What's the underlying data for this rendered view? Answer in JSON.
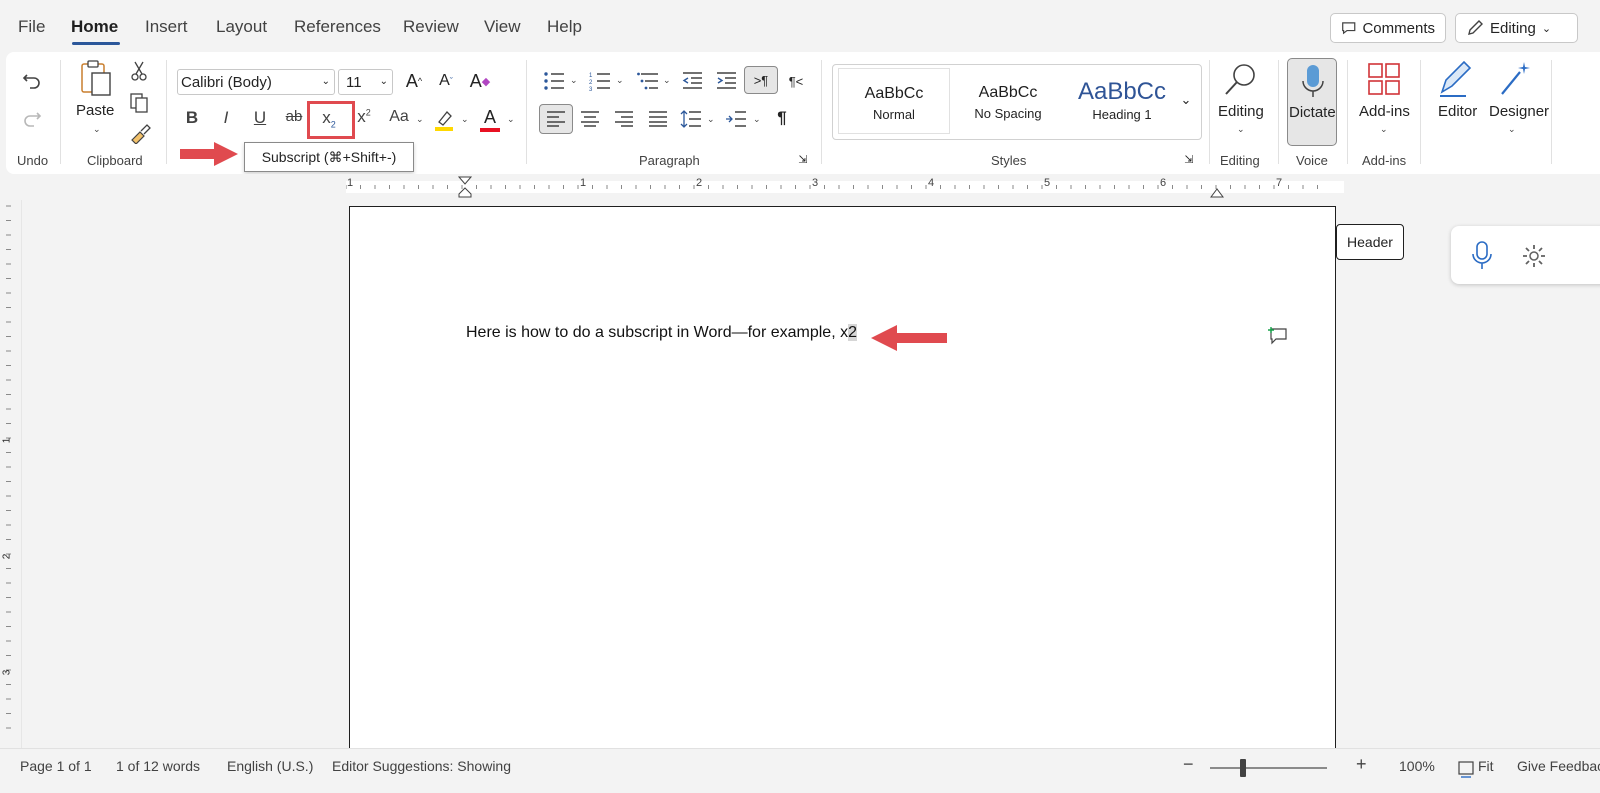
{
  "menu": {
    "tabs": [
      {
        "label": "File"
      },
      {
        "label": "Home"
      },
      {
        "label": "Insert"
      },
      {
        "label": "Layout"
      },
      {
        "label": "References"
      },
      {
        "label": "Review"
      },
      {
        "label": "View"
      },
      {
        "label": "Help"
      }
    ],
    "active_tab": "Home",
    "comments_label": "Comments",
    "editing_label": "Editing"
  },
  "ribbon": {
    "groups": {
      "undo": "Undo",
      "clipboard": "Clipboard",
      "paragraph": "Paragraph",
      "styles": "Styles",
      "editing": "Editing",
      "voice": "Voice",
      "addins": "Add-ins"
    },
    "paste_label": "Paste",
    "font_name": "Calibri (Body)",
    "font_size": "11",
    "styles": [
      {
        "sample": "AaBbCc",
        "name": "Normal"
      },
      {
        "sample": "AaBbCc",
        "name": "No Spacing"
      },
      {
        "sample": "AaBbCc",
        "name": "Heading 1"
      }
    ],
    "editing_btn": "Editing",
    "dictate_btn": "Dictate",
    "addins_btn": "Add-ins",
    "editor_btn": "Editor",
    "designer_btn": "Designer",
    "font_color": "#e81123",
    "highlight_color": "#ffd800"
  },
  "tooltip": "Subscript (⌘+Shift+-)",
  "ruler_numbers": [
    "1",
    "1",
    "2",
    "3",
    "4",
    "5",
    "6",
    "7"
  ],
  "vruler_numbers": [
    "1",
    "2",
    "3"
  ],
  "document": {
    "text": "Here is how to do a subscript in Word—for example, x",
    "highlighted": "2"
  },
  "header_label": "Header",
  "status": {
    "page": "Page 1 of 1",
    "words": "1 of 12 words",
    "language": "English (U.S.)",
    "editor": "Editor Suggestions: Showing",
    "zoom": "100%",
    "fit": "Fit",
    "feedback": "Give Feedbac"
  },
  "accent_color": "#2b579a",
  "annotation_color": "#e04a4f"
}
